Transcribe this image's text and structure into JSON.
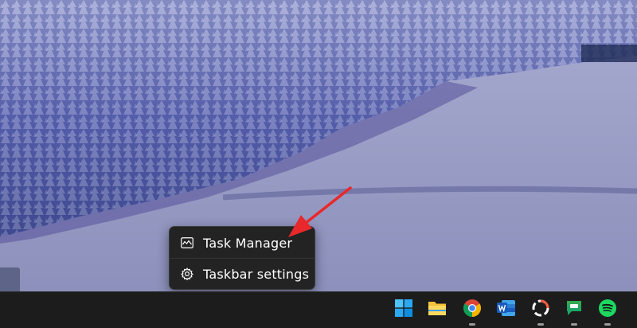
{
  "context_menu": {
    "items": [
      {
        "label": "Task Manager",
        "icon": "task-manager-icon"
      },
      {
        "label": "Taskbar settings",
        "icon": "gear-icon"
      }
    ]
  },
  "taskbar": {
    "apps": [
      {
        "name": "Start",
        "icon": "windows-start-icon",
        "running": false
      },
      {
        "name": "File Explorer",
        "icon": "file-explorer-icon",
        "running": false
      },
      {
        "name": "Google Chrome",
        "icon": "chrome-icon",
        "running": true
      },
      {
        "name": "Microsoft Word",
        "icon": "word-icon",
        "running": false
      },
      {
        "name": "Screen recorder",
        "icon": "recorder-icon",
        "running": true
      },
      {
        "name": "Google Chat",
        "icon": "chat-icon",
        "running": true
      },
      {
        "name": "Spotify",
        "icon": "spotify-icon",
        "running": true
      }
    ]
  },
  "colors": {
    "menu_background": "#232323",
    "taskbar_background": "#1c1c1c",
    "annotation_arrow": "#e8282b",
    "lake": "#9a9dc4"
  }
}
